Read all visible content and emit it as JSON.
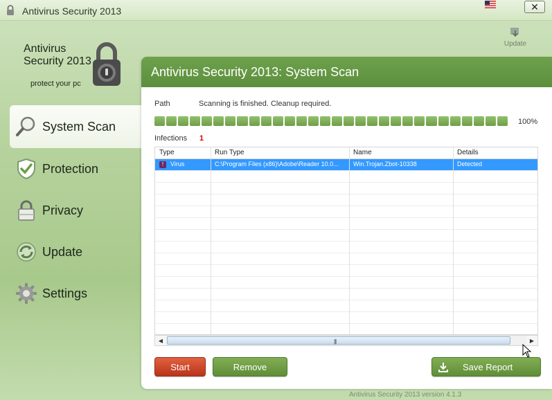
{
  "window": {
    "title": "Antivirus Security 2013",
    "close_label": "✕"
  },
  "brand": {
    "name": "Antivirus Security 2013",
    "tagline": "protect your pc"
  },
  "topbar": {
    "update_label": "Update"
  },
  "sidebar": {
    "items": [
      {
        "label": "System Scan",
        "icon": "magnifier-icon",
        "active": true
      },
      {
        "label": "Protection",
        "icon": "shield-icon",
        "active": false
      },
      {
        "label": "Privacy",
        "icon": "padlock-icon",
        "active": false
      },
      {
        "label": "Update",
        "icon": "refresh-icon",
        "active": false
      },
      {
        "label": "Settings",
        "icon": "gear-icon",
        "active": false
      }
    ]
  },
  "main": {
    "title": "Antivirus Security 2013: System Scan",
    "path_label": "Path",
    "scan_status": "Scanning is finished. Cleanup required.",
    "progress_percent_label": "100%",
    "progress": 1.0,
    "infections_label": "Infections",
    "infections_count": "1",
    "table": {
      "columns": [
        "Type",
        "Run Type",
        "Name",
        "Details"
      ],
      "rows": [
        {
          "type": "Virus",
          "run_type": "C:\\Program Files (x86)\\Adobe\\Reader 10.0...",
          "name": "Win.Trojan.Zbot-10338",
          "details": "Detected"
        }
      ]
    },
    "buttons": {
      "start": "Start",
      "remove": "Remove",
      "save_report": "Save Report"
    }
  },
  "footer": {
    "version": "Antivirus Security 2013 version 4.1.3"
  },
  "colors": {
    "accent_green": "#5c8f3d",
    "start_red": "#b8341b",
    "selection_blue": "#3399ff",
    "infection_red": "#d10000"
  }
}
